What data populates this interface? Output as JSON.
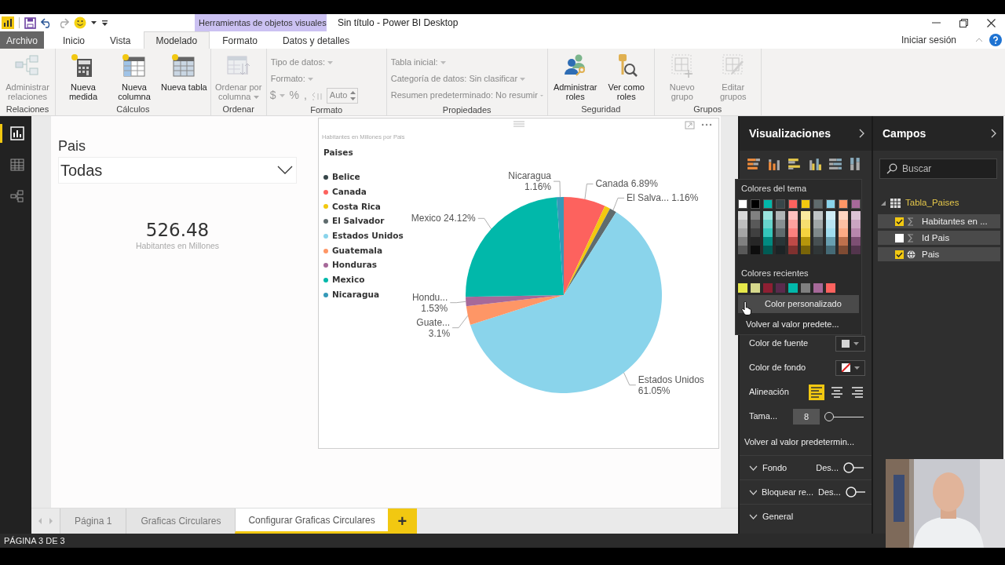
{
  "title_bar": {
    "context_header": "Herramientas de objetos visuales",
    "title": "Sin título - Power BI Desktop"
  },
  "ribbon_tabs": [
    {
      "label": "Archivo",
      "kind": "file",
      "selected": false
    },
    {
      "label": "Inicio",
      "kind": "main",
      "selected": false
    },
    {
      "label": "Vista",
      "kind": "main",
      "selected": false
    },
    {
      "label": "Modelado",
      "kind": "main",
      "selected": true
    },
    {
      "label": "Formato",
      "kind": "context",
      "selected": false
    },
    {
      "label": "Datos y detalles",
      "kind": "context",
      "selected": false
    }
  ],
  "sign_in": "Iniciar sesión",
  "ribbon_groups": [
    {
      "label": "Relaciones",
      "kind": "buttons",
      "buttons": [
        {
          "label": "Administrar relaciones",
          "disabled": true,
          "has_menu": false
        }
      ]
    },
    {
      "label": "Cálculos",
      "kind": "buttons",
      "buttons": [
        {
          "label": "Nueva medida",
          "disabled": false,
          "has_menu": false
        },
        {
          "label": "Nueva columna",
          "disabled": false,
          "has_menu": false
        },
        {
          "label": "Nueva tabla",
          "disabled": false,
          "has_menu": false
        }
      ]
    },
    {
      "label": "Ordenar",
      "kind": "buttons",
      "buttons": [
        {
          "label": "Ordenar por columna",
          "disabled": true,
          "has_menu": true
        }
      ]
    },
    {
      "label": "Formato",
      "kind": "format",
      "items": [
        {
          "label": "Tipo de datos:",
          "disabled": true
        },
        {
          "label": "Formato:",
          "disabled": true
        }
      ],
      "tools": [
        {
          "text": "$",
          "has_menu": true
        },
        {
          "text": "%",
          "has_menu": false
        },
        {
          "text": ",",
          "has_menu": false
        }
      ],
      "spinner": "Auto"
    },
    {
      "label": "Propiedades",
      "kind": "fields",
      "items": [
        {
          "label": "Tabla inicial:",
          "disabled": true
        },
        {
          "label": "Categoría de datos: Sin clasificar",
          "disabled": true
        },
        {
          "label": "Resumen predeterminado: No resumir",
          "disabled": true
        }
      ]
    },
    {
      "label": "Seguridad",
      "kind": "buttons",
      "buttons": [
        {
          "label": "Administrar roles",
          "disabled": false,
          "has_menu": false
        },
        {
          "label": "Ver como roles",
          "disabled": false,
          "has_menu": false
        }
      ]
    },
    {
      "label": "Grupos",
      "kind": "buttons",
      "buttons": [
        {
          "label": "Nuevo grupo",
          "disabled": true,
          "has_menu": false
        },
        {
          "label": "Editar grupos",
          "disabled": true,
          "has_menu": false
        }
      ]
    }
  ],
  "views": [
    {
      "kind": "report",
      "selected": true
    },
    {
      "kind": "data",
      "selected": false
    },
    {
      "kind": "model",
      "selected": false
    }
  ],
  "page": {
    "slicer": {
      "title": "Pais",
      "value": "Todas"
    },
    "card": {
      "value": "526.48",
      "label": "Habitantes en Millones"
    },
    "chart": {
      "legend_title": "Paises",
      "chart_data": {
        "type": "pie",
        "title": "Habitantes en Millones por Pais",
        "legend": "left",
        "categories": [
          "Belice",
          "Canada",
          "Costa Rica",
          "El Salvador",
          "Estados Unidos",
          "Guatemala",
          "Honduras",
          "Mexico",
          "Nicaragua"
        ],
        "values": [
          null,
          6.89,
          0.92,
          1.16,
          61.05,
          3.1,
          1.53,
          24.12,
          1.16
        ],
        "colors": [
          "#374649",
          "#fd625e",
          "#f2c80f",
          "#5f6b6d",
          "#8ad4eb",
          "#fe9666",
          "#a66999",
          "#01b8aa",
          "#3599b8"
        ],
        "annotations": [
          null,
          {
            "text": "Canada 6.89%"
          },
          null,
          {
            "text": "El Salva... 1.16%"
          },
          {
            "text": "Estados Unidos\n61.05%"
          },
          {
            "text": "Guate...\n3.1%"
          },
          {
            "text": "Hondu...\n1.53%"
          },
          {
            "text": "Mexico 24.12%"
          },
          {
            "text": "Nicaragua\n1.16%"
          }
        ]
      }
    }
  },
  "page_tabs": [
    {
      "label": "Página 1",
      "selected": false
    },
    {
      "label": "Graficas Circulares",
      "selected": false
    },
    {
      "label": "Configurar Graficas Circulares",
      "selected": true
    }
  ],
  "add_page": "+",
  "visualizations": {
    "title": "Visualizaciones",
    "popup": {
      "theme_title": "Colores del tema",
      "theme_colors": [
        {
          "color": "#ffffff"
        },
        {
          "color": "#000000"
        },
        {
          "color": "#01b8aa"
        },
        {
          "color": "#374649"
        },
        {
          "color": "#fd625e"
        },
        {
          "color": "#f2c80f"
        },
        {
          "color": "#5f6b6d"
        },
        {
          "color": "#8ad4eb"
        },
        {
          "color": "#fe9666"
        },
        {
          "color": "#a66999"
        }
      ],
      "recent_title": "Colores recientes",
      "recent_colors": [
        {
          "color": "#e6e84a"
        },
        {
          "color": "#d6d88c"
        },
        {
          "color": "#8e1f33"
        },
        {
          "color": "#5a2a4d"
        },
        {
          "color": "#01b8aa"
        },
        {
          "color": "#7f7f7f"
        },
        {
          "color": "#a66999"
        },
        {
          "color": "#fd625e"
        }
      ],
      "items": [
        {
          "label": "Color personalizado",
          "highlighted": true
        },
        {
          "label": "Volver al valor predete...",
          "highlighted": false
        }
      ]
    },
    "rows": [
      {
        "kind": "color",
        "label": "Color de fuente",
        "color": "#d4d4d4"
      },
      {
        "kind": "no-color",
        "label": "Color de fondo"
      },
      {
        "kind": "align",
        "label": "Alineación",
        "options": [
          {
            "selected": true
          },
          {
            "selected": false
          },
          {
            "selected": false
          }
        ]
      },
      {
        "kind": "slider",
        "label": "Tama...",
        "value": "8",
        "level": 0
      },
      {
        "kind": "link",
        "label": "Volver al valor predetermin..."
      },
      {
        "kind": "section",
        "label": "Fondo",
        "toggle_text": "Des...",
        "on": false,
        "expanded": false
      },
      {
        "kind": "section",
        "label": "Bloquear re...",
        "toggle_text": "Des...",
        "on": false,
        "expanded": false
      },
      {
        "kind": "section",
        "label": "General",
        "expanded": false
      }
    ]
  },
  "fields": {
    "title": "Campos",
    "search_placeholder": "Buscar",
    "tables": [
      {
        "label": "Tabla_Paises",
        "expanded": true,
        "children": [
          {
            "label": "Habitantes en ...",
            "kind": "measure",
            "checked": true
          },
          {
            "label": "Id Pais",
            "kind": "measure",
            "checked": false
          },
          {
            "label": "Pais",
            "kind": "geo",
            "checked": true
          }
        ]
      }
    ]
  },
  "status_bar": "PÁGINA 3 DE 3"
}
